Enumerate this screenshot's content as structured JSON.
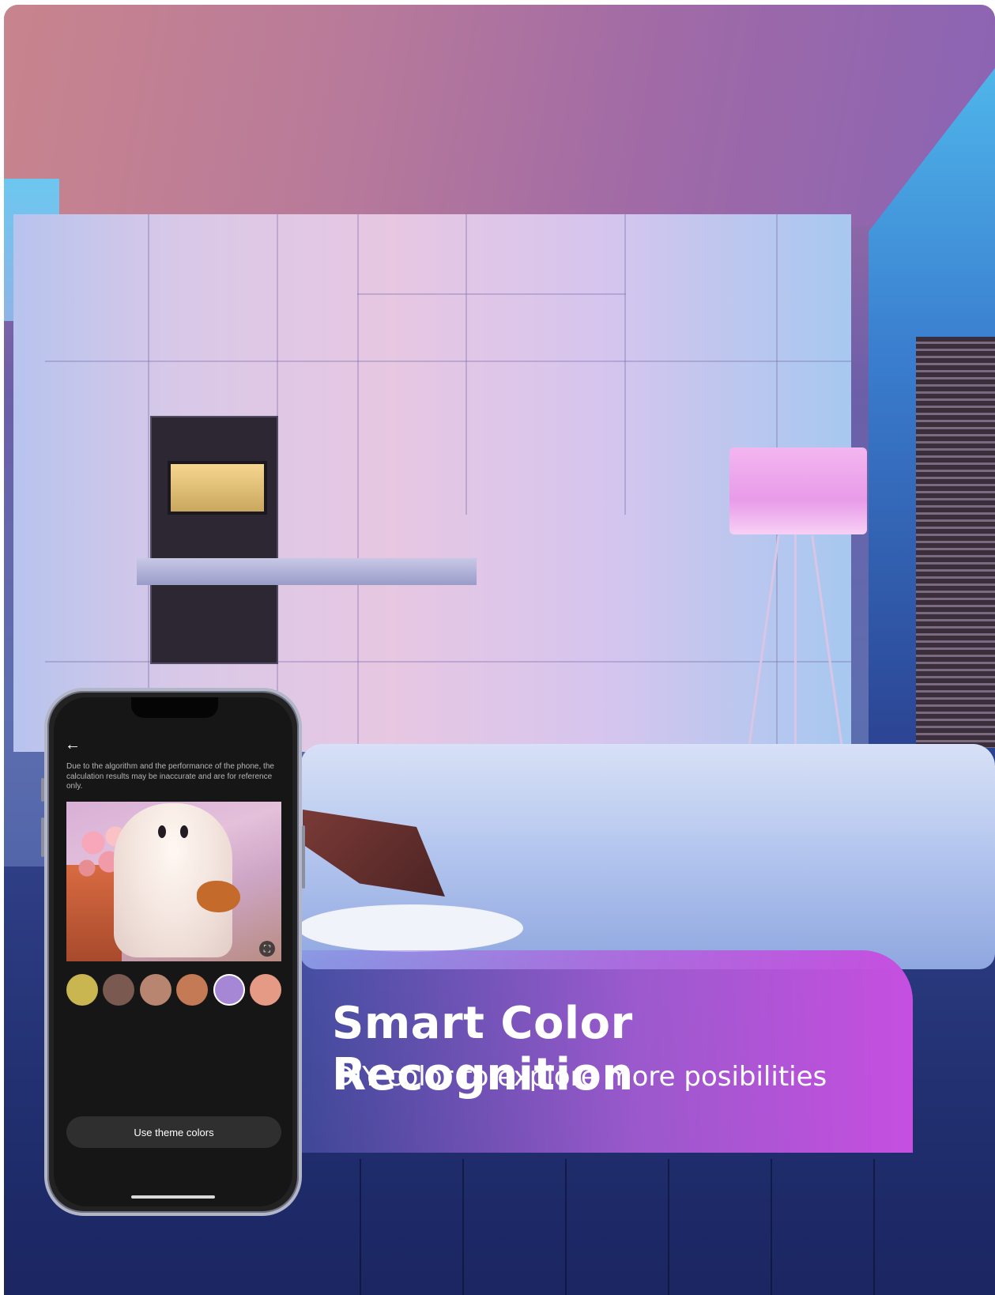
{
  "banner": {
    "title": "Smart Color Recognition",
    "subtitle": "DIY color to explore more posibilities"
  },
  "app": {
    "back_icon": "arrow-left-icon",
    "disclaimer": "Due to the algorithm and the performance of the phone, the calculation results may be inaccurate and are for reference only.",
    "expand_icon": "expand-icon",
    "swatches": [
      {
        "color": "#c9b650"
      },
      {
        "color": "#7a5a50"
      },
      {
        "color": "#b88670"
      },
      {
        "color": "#c47a54"
      },
      {
        "color": "#a687d6",
        "selected": true
      },
      {
        "color": "#e59a86"
      }
    ],
    "theme_button_label": "Use theme colors"
  },
  "colors": {
    "banner_gradient_end": "#c64fe0",
    "phone_screen": "#161616"
  }
}
